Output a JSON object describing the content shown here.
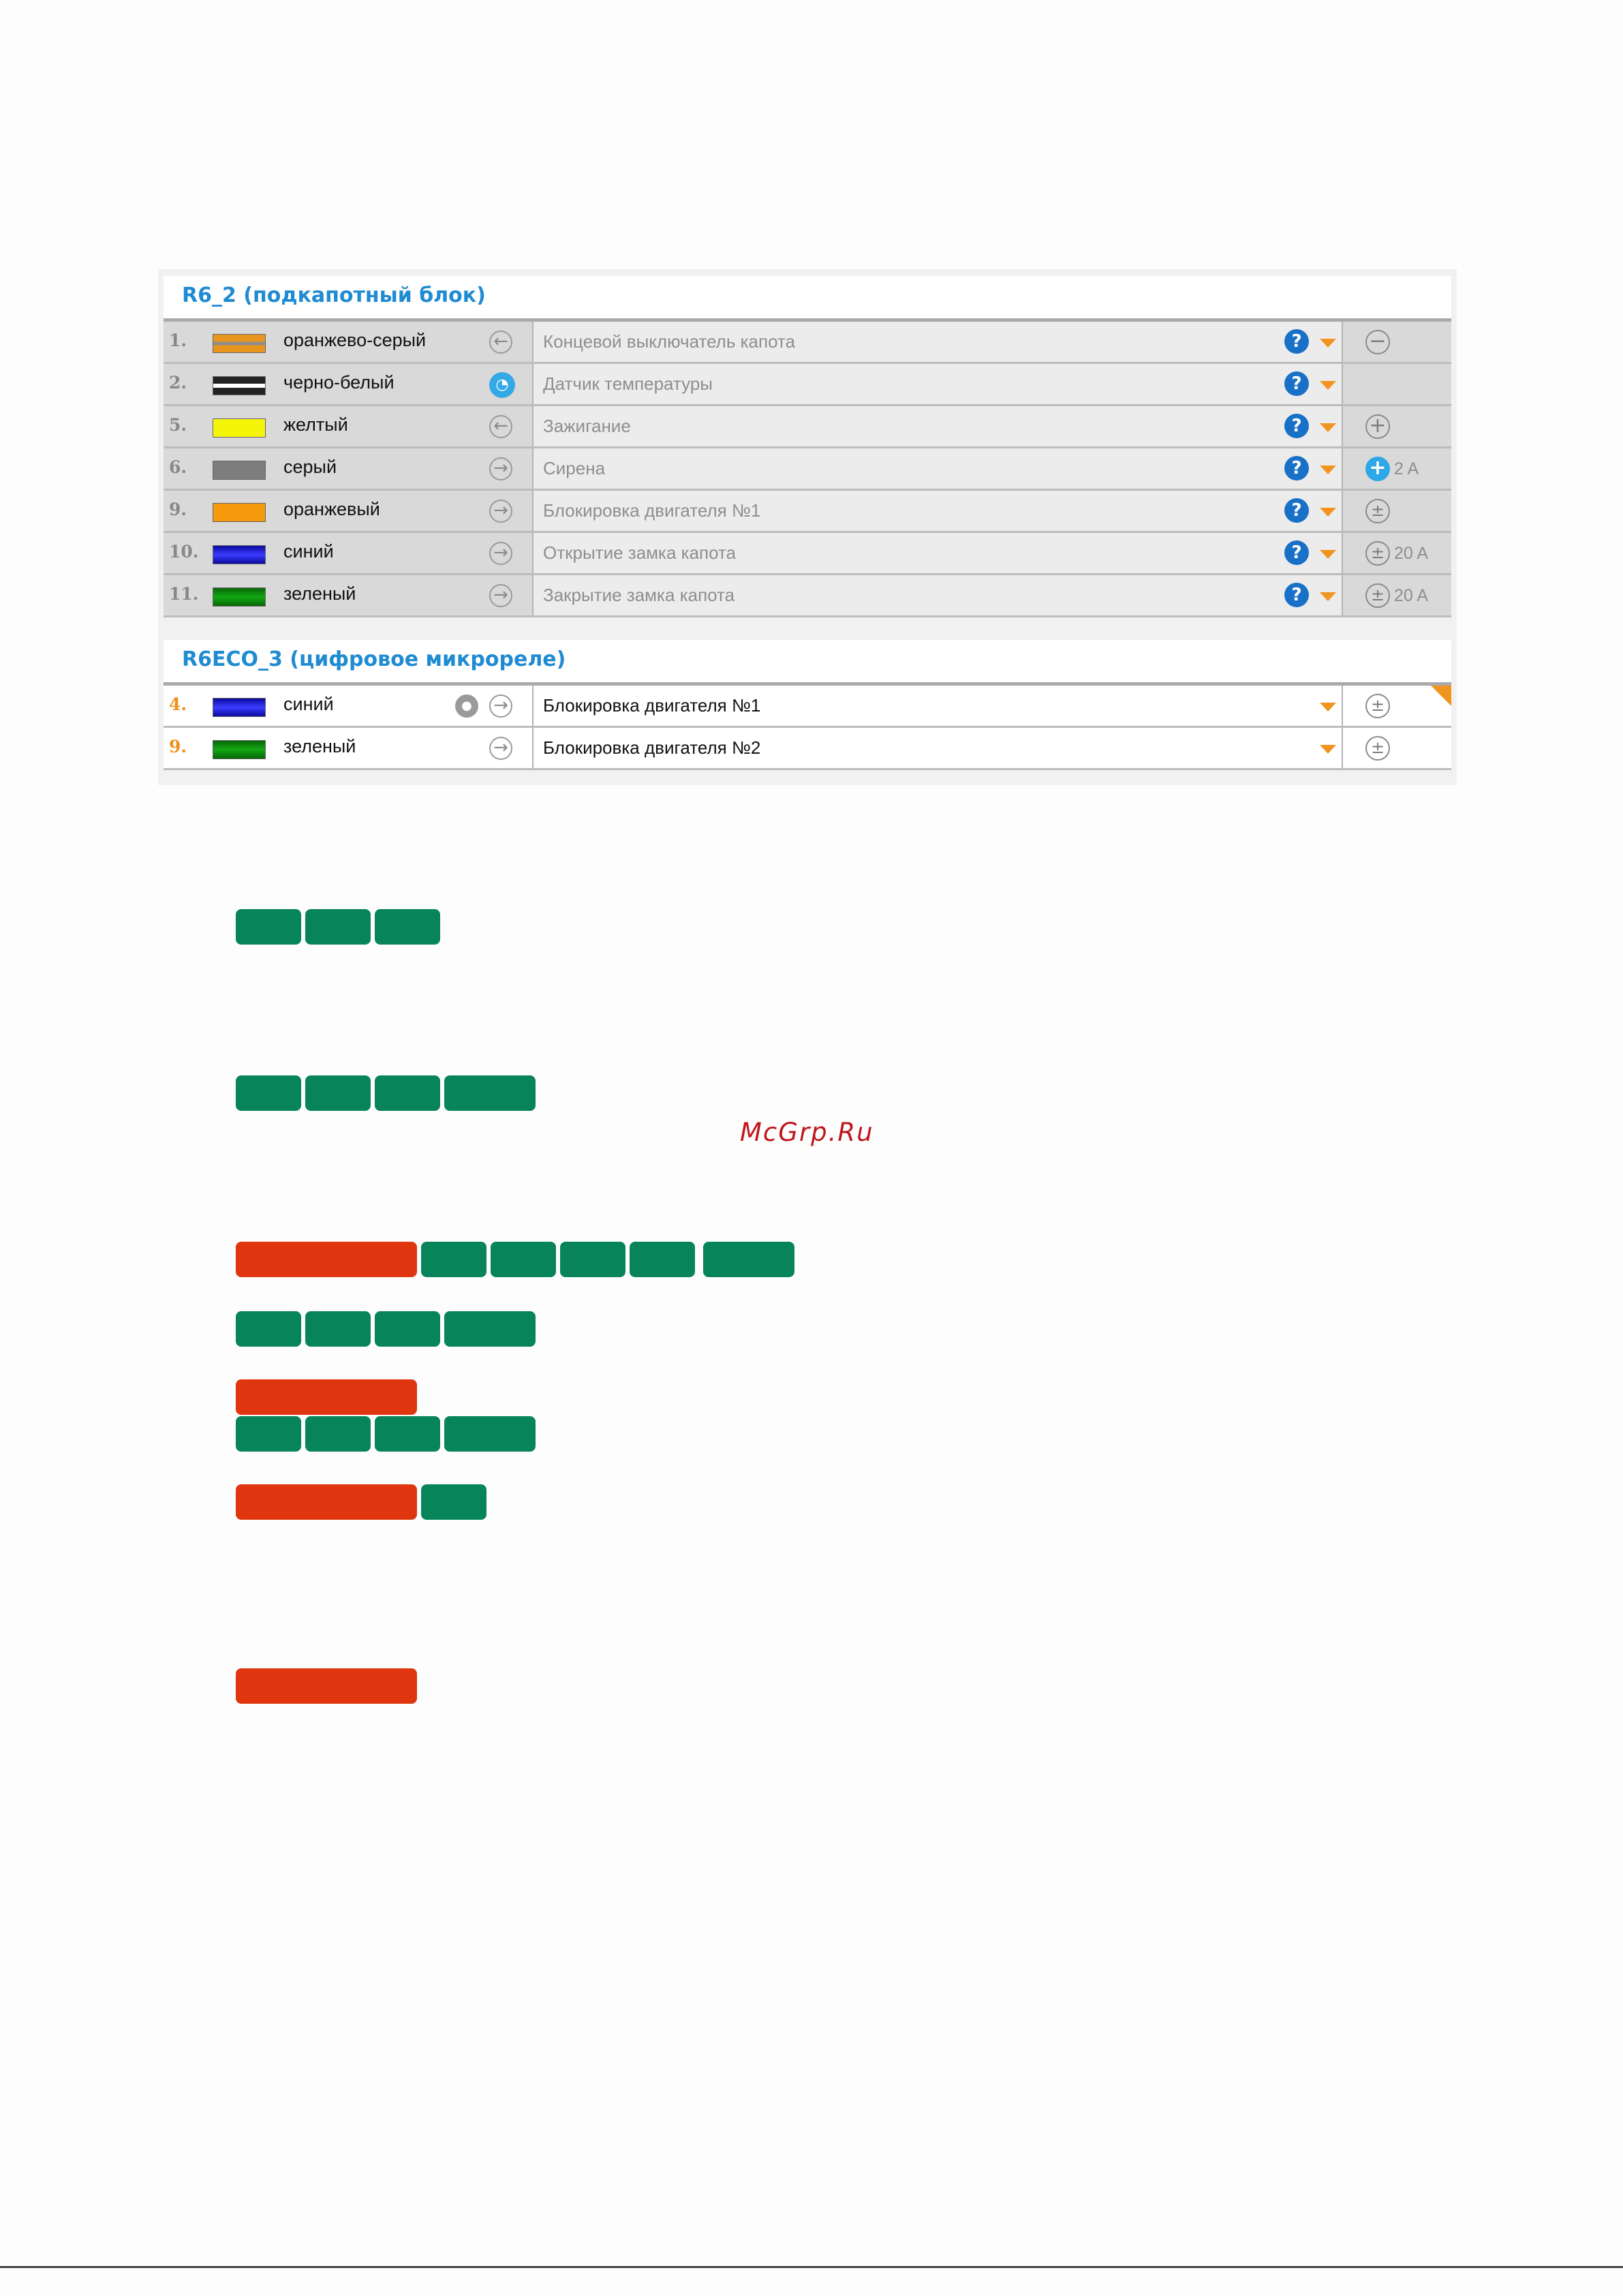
{
  "sections": [
    {
      "title": "R6_2 (подкапотный блок)",
      "rows": [
        {
          "num": "1.",
          "wire": "оранжево-серый",
          "direction": "input",
          "func": "Концевой выключатель капота",
          "protection": "minus",
          "amp": ""
        },
        {
          "num": "2.",
          "wire": "черно-белый",
          "direction": "gauge",
          "func": "Датчик температуры",
          "protection": "",
          "amp": ""
        },
        {
          "num": "5.",
          "wire": "желтый",
          "direction": "input",
          "func": "Зажигание",
          "protection": "plus",
          "amp": ""
        },
        {
          "num": "6.",
          "wire": "серый",
          "direction": "output",
          "func": "Сирена",
          "protection": "plus-active",
          "amp": "2 A"
        },
        {
          "num": "9.",
          "wire": "оранжевый",
          "direction": "output",
          "func": "Блокировка двигателя №1",
          "protection": "plusminus",
          "amp": ""
        },
        {
          "num": "10.",
          "wire": "синий",
          "direction": "output",
          "func": "Открытие замка капота",
          "protection": "plusminus",
          "amp": "20 A"
        },
        {
          "num": "11.",
          "wire": "зеленый",
          "direction": "output",
          "func": "Закрытие замка капота",
          "protection": "plusminus",
          "amp": "20 A"
        }
      ]
    },
    {
      "title": "R6ECO_3 (цифровое микрореле)",
      "rows": [
        {
          "num": "4.",
          "wire": "синий",
          "direction": "output",
          "func": "Блокировка двигателя №1",
          "protection": "plusminus",
          "amp": ""
        },
        {
          "num": "9.",
          "wire": "зеленый",
          "direction": "output",
          "func": "Блокировка двигателя №2",
          "protection": "plusminus",
          "amp": ""
        }
      ]
    }
  ],
  "icons": {
    "input": "arrow-left-icon",
    "output": "arrow-right-icon",
    "gauge": "temperature-gauge-icon",
    "help": "question-icon",
    "dropdown": "caret-down-icon"
  },
  "colors": {
    "section_title": "#1f8bd2",
    "help": "#1871c7",
    "accent_orange": "#f29420",
    "redacted_green": "#08845b",
    "redacted_red": "#df3610",
    "wire_orange_gray": "#e8951e",
    "wire_black_white": "#222222",
    "wire_yellow": "#f5f50a",
    "wire_gray": "#7d7d7d",
    "wire_orange": "#f59a0c",
    "wire_blue": "#1c1ce6",
    "wire_green": "#0e8f0e"
  },
  "watermark": "McGrp.Ru"
}
